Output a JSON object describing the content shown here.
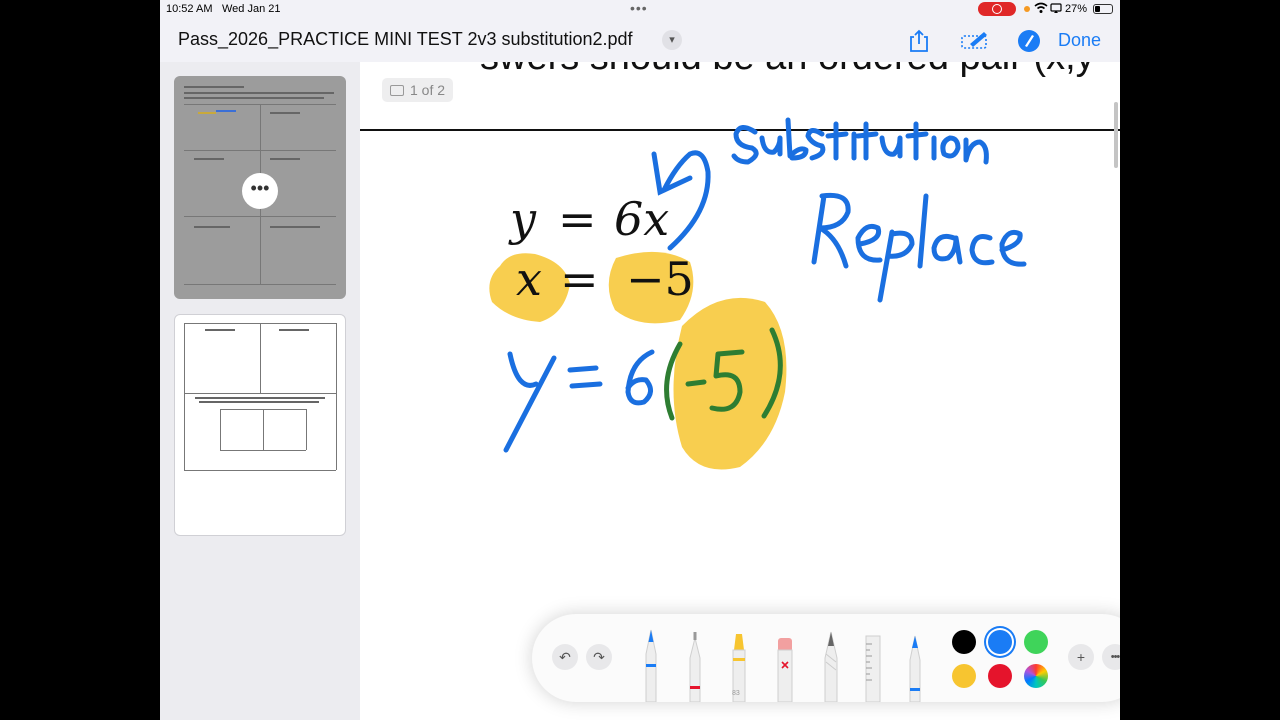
{
  "status_bar": {
    "time": "10:52 AM",
    "date": "Wed Jan 21",
    "battery": "27%",
    "icons": [
      "recording-indicator-icon",
      "wifi-icon",
      "screen-mirror-icon",
      "battery-icon"
    ]
  },
  "title_bar": {
    "title": "Pass_2026_PRACTICE MINI TEST 2v3 substitution2.pdf",
    "done_label": "Done",
    "icons": [
      "chevron-down-icon",
      "share-icon",
      "markup-icon",
      "pencil-circle-icon"
    ],
    "accent_color": "#1a7cf5"
  },
  "sidebar": {
    "thumbnails": [
      {
        "label": "page-1",
        "selected": true
      },
      {
        "label": "page-2",
        "selected": false
      }
    ],
    "more_label": "•••"
  },
  "document": {
    "page_indicator": "1 of 2",
    "heading_fragment": "swers should be an ordered pair (x,y",
    "equations": {
      "eq1_lhs": "y",
      "eq1_eq": "=",
      "eq1_rhs": "6x",
      "eq2_lhs": "x",
      "eq2_eq": "=",
      "eq2_rhs": "−5"
    },
    "handwriting": {
      "word1": "Substitution",
      "word2": "Replace",
      "work": "y = 6(-5)"
    }
  },
  "markup_toolbar": {
    "undo": "↶",
    "redo": "↷",
    "tools": [
      "pen",
      "monoline",
      "highlighter",
      "eraser",
      "pencil",
      "ruler",
      "fountain-pen"
    ],
    "highlighter_width": "83",
    "colors": [
      {
        "name": "black",
        "hex": "#000000"
      },
      {
        "name": "blue",
        "hex": "#1a7cf5",
        "selected": true
      },
      {
        "name": "green",
        "hex": "#3fd45a"
      },
      {
        "name": "yellow",
        "hex": "#f7c530"
      },
      {
        "name": "red",
        "hex": "#e5142c"
      },
      {
        "name": "multicolor",
        "hex": "#ff00ff"
      }
    ],
    "add_label": "+",
    "more_label": "•••"
  }
}
